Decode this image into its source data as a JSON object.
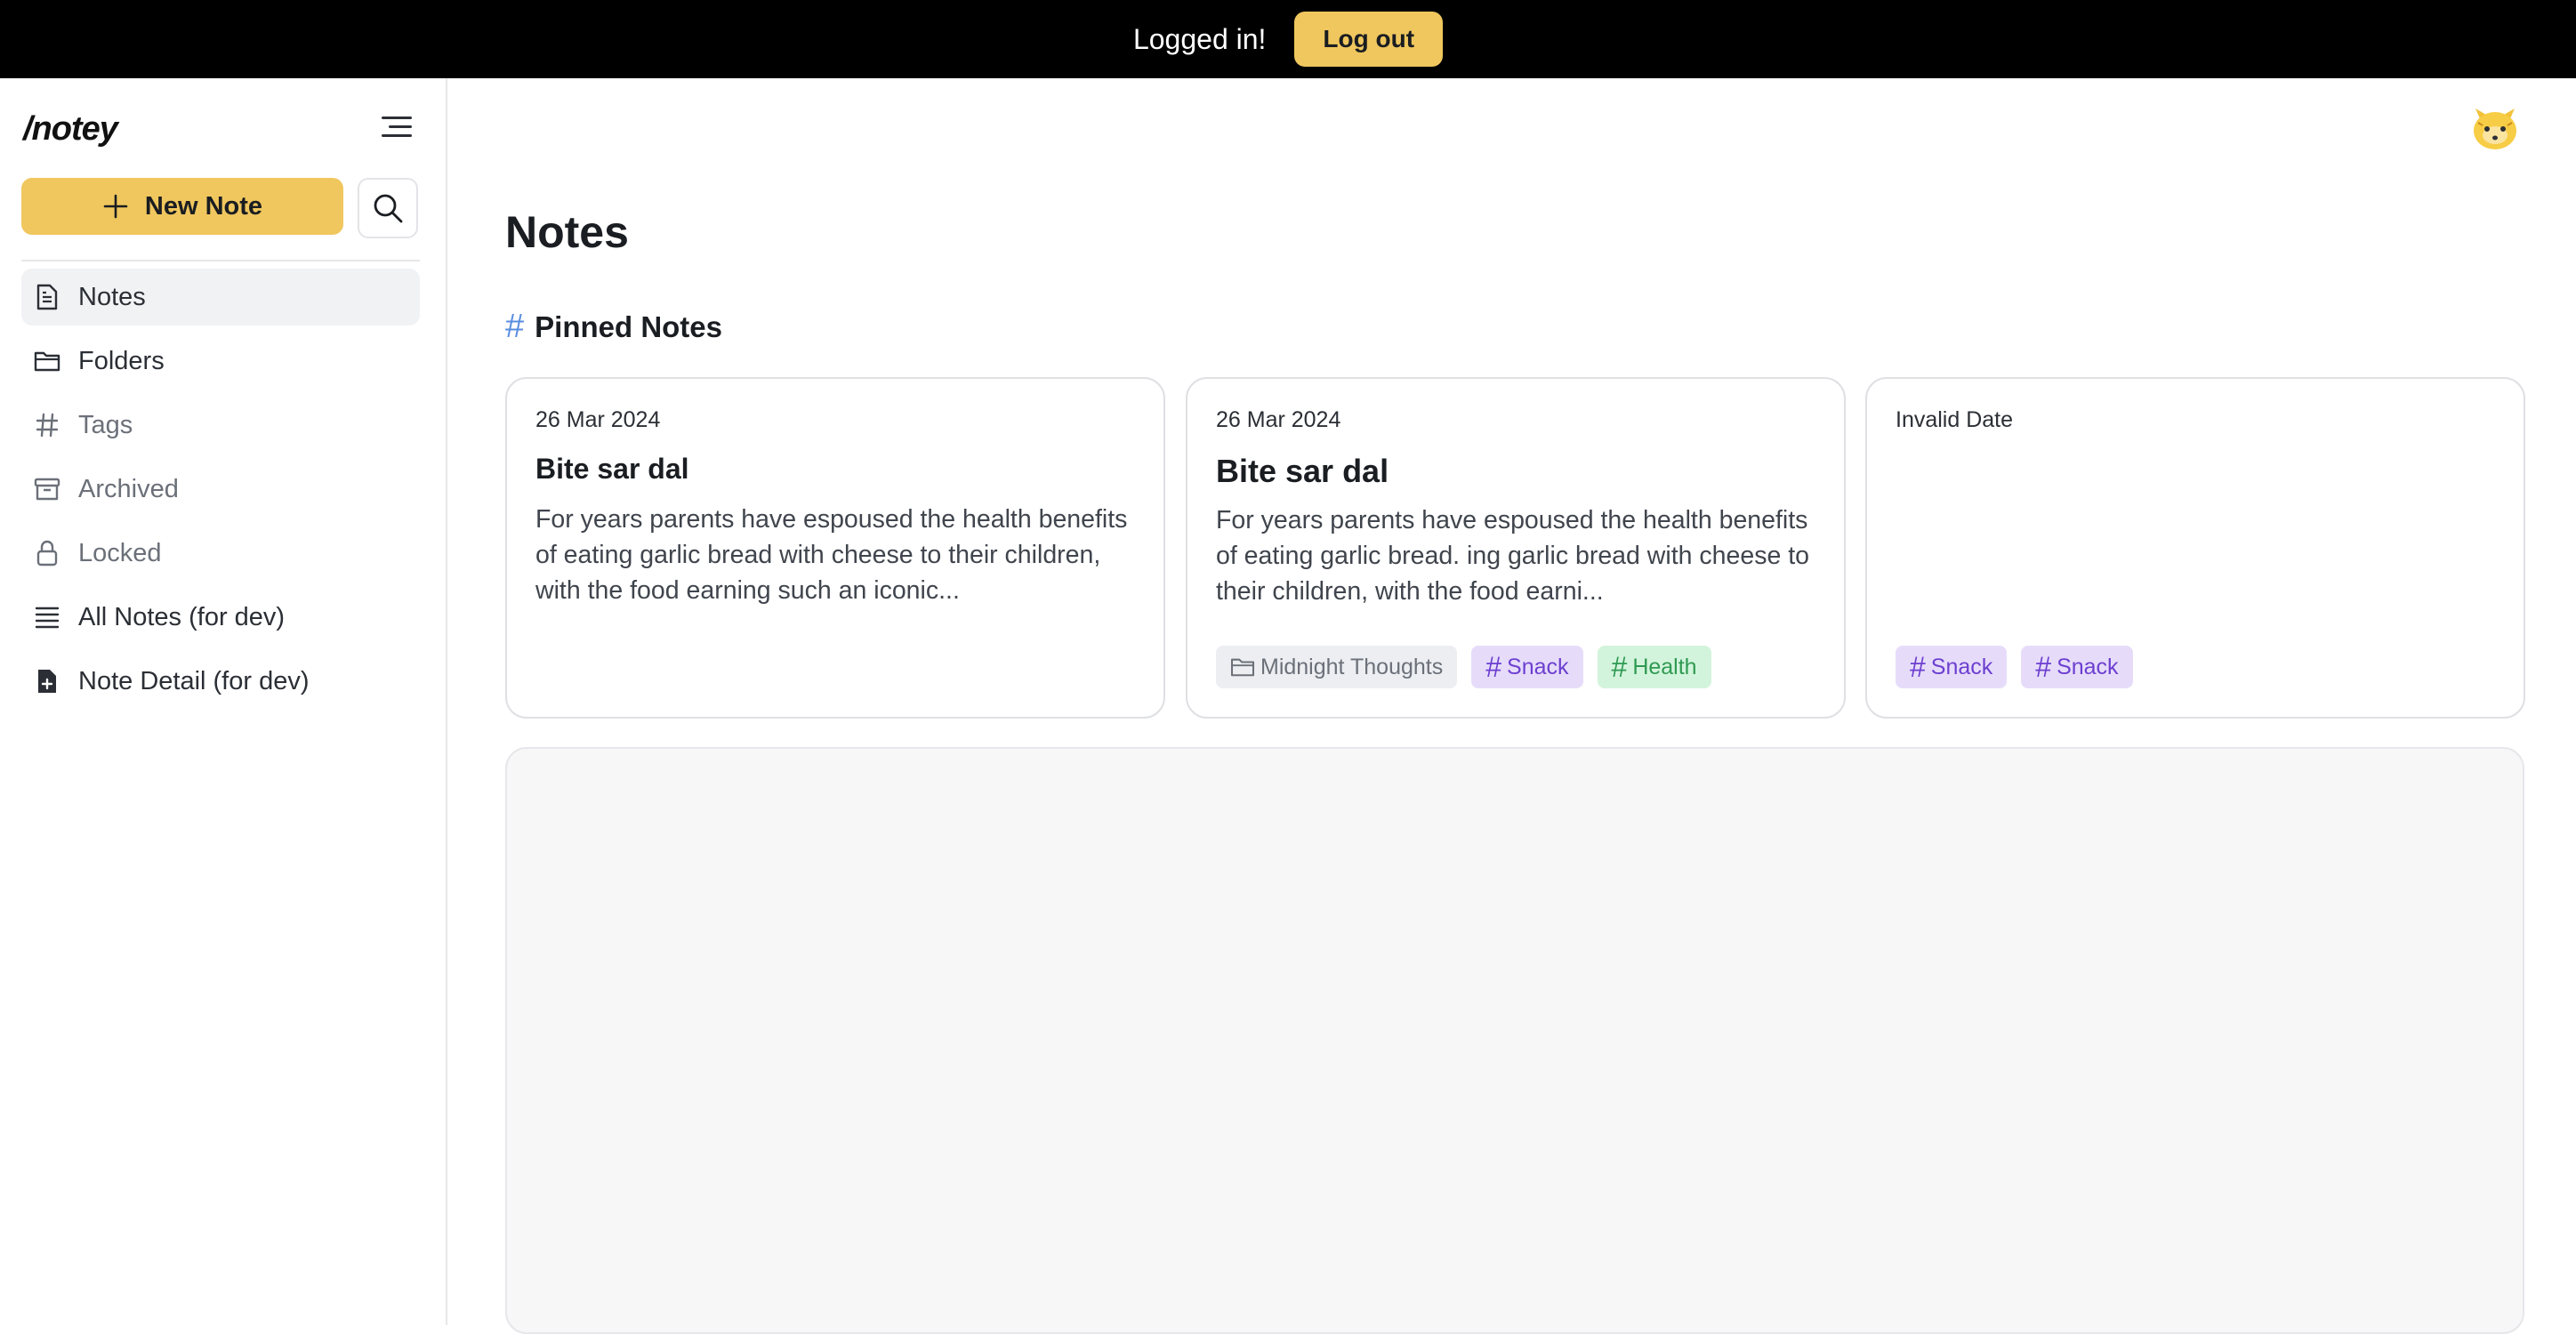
{
  "topbar": {
    "message": "Logged in!",
    "logout_label": "Log out"
  },
  "sidebar": {
    "logo": "/notey",
    "new_note_label": "New Note",
    "nav": [
      {
        "label": "Notes",
        "icon": "document-icon"
      },
      {
        "label": "Folders",
        "icon": "folder-icon"
      },
      {
        "label": "Tags",
        "icon": "hash-icon"
      },
      {
        "label": "Archived",
        "icon": "archive-icon"
      },
      {
        "label": "Locked",
        "icon": "lock-icon"
      },
      {
        "label": "All Notes (for dev)",
        "icon": "list-icon"
      },
      {
        "label": "Note Detail (for dev)",
        "icon": "file-plus-icon"
      }
    ]
  },
  "main": {
    "title": "Notes",
    "pinned_label": "Pinned Notes",
    "hash_symbol": "#",
    "cards": [
      {
        "date": "26 Mar 2024",
        "title": "Bite sar dal",
        "excerpt": "For years parents have espoused the health benefits of eating garlic bread with cheese to their children, with the food earning such an iconic..."
      },
      {
        "date": "26 Mar 2024",
        "title": "Bite sar dal",
        "excerpt": "For years parents have espoused the health benefits of eating garlic bread. ing garlic bread with cheese to their children, with the food earni...",
        "folder": "Midnight Thoughts",
        "tags": [
          "Snack",
          "Health"
        ]
      },
      {
        "date": "Invalid Date",
        "tags": [
          "Snack",
          "Snack"
        ]
      }
    ]
  },
  "colors": {
    "accent": "#f0c75e",
    "hash_blue": "#5a8de0",
    "tag_purple": "#6d3fd0",
    "tag_green": "#2f9a52"
  }
}
